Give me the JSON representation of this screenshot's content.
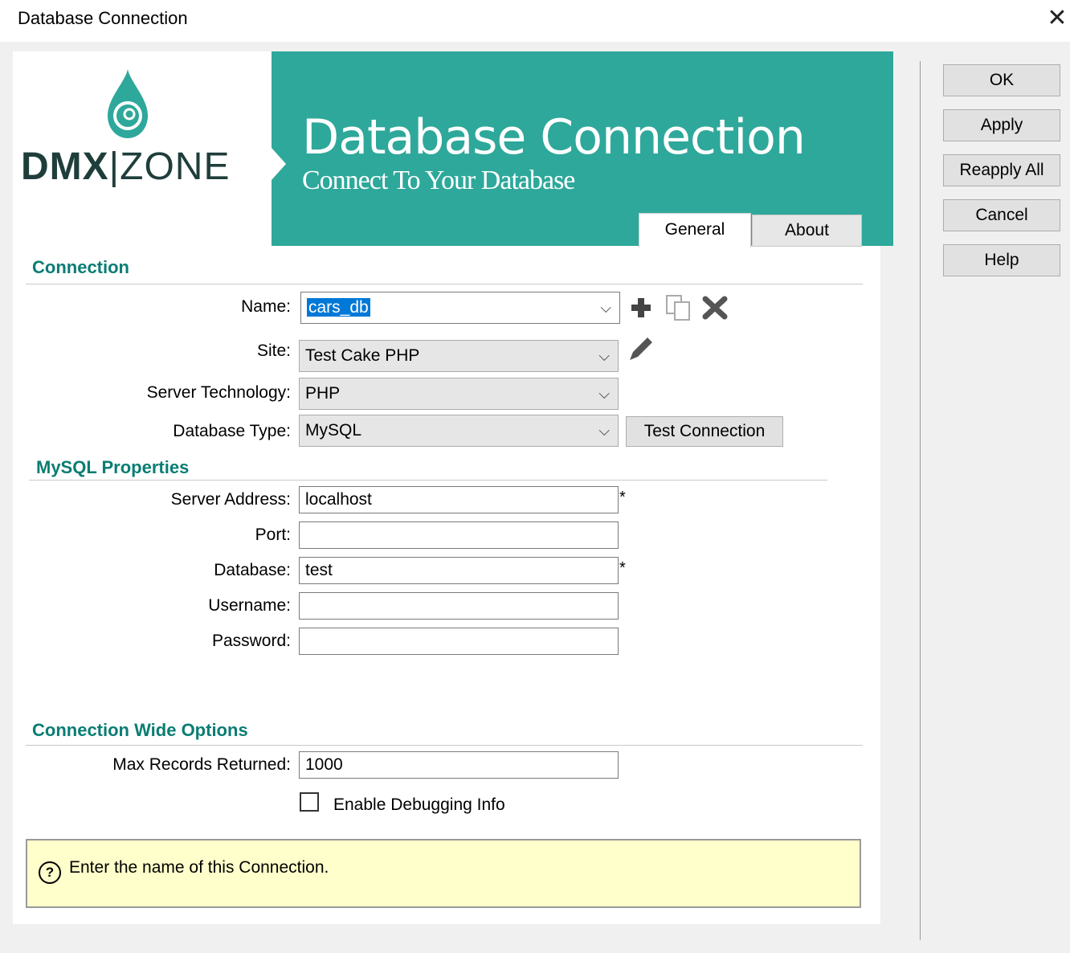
{
  "window": {
    "title": "Database Connection",
    "close_glyph": "✕"
  },
  "logo": {
    "brand_bold": "DMX",
    "brand_light": "ZONE",
    "divider": "|"
  },
  "banner": {
    "title": "Database Connection",
    "subtitle": "Connect To Your Database"
  },
  "tabs": [
    {
      "label": "General",
      "active": true
    },
    {
      "label": "About",
      "active": false
    }
  ],
  "sections": {
    "connection": "Connection",
    "mysql": "MySQL Properties",
    "wide": "Connection Wide Options"
  },
  "fields": {
    "name": {
      "label": "Name:",
      "value": "cars_db"
    },
    "site": {
      "label": "Site:",
      "value": "Test Cake PHP"
    },
    "server_tech": {
      "label": "Server Technology:",
      "value": "PHP"
    },
    "db_type": {
      "label": "Database Type:",
      "value": "MySQL"
    },
    "server_address": {
      "label": "Server Address:",
      "value": "localhost"
    },
    "port": {
      "label": "Port:",
      "value": ""
    },
    "database": {
      "label": "Database:",
      "value": "test"
    },
    "username": {
      "label": "Username:",
      "value": ""
    },
    "password": {
      "label": "Password:",
      "value": ""
    },
    "max_records": {
      "label": "Max Records Returned:",
      "value": "1000"
    }
  },
  "required_marker": "*",
  "test_connection_label": "Test Connection",
  "debug_checkbox": {
    "label": "Enable Debugging Info",
    "checked": false
  },
  "help": {
    "text": "Enter the name of this Connection.",
    "icon_glyph": "?"
  },
  "buttons": {
    "ok": "OK",
    "apply": "Apply",
    "reapply_all": "Reapply All",
    "cancel": "Cancel",
    "help": "Help"
  },
  "icons": {
    "add": "plus-icon",
    "duplicate": "copy-icon",
    "delete": "delete-x-icon",
    "edit": "pencil-icon",
    "dropdown": "chevron-down-icon"
  },
  "colors": {
    "banner": "#2ea89b",
    "section_heading": "#0a7d73",
    "help_background": "#ffffcb",
    "selection": "#0078d7"
  }
}
